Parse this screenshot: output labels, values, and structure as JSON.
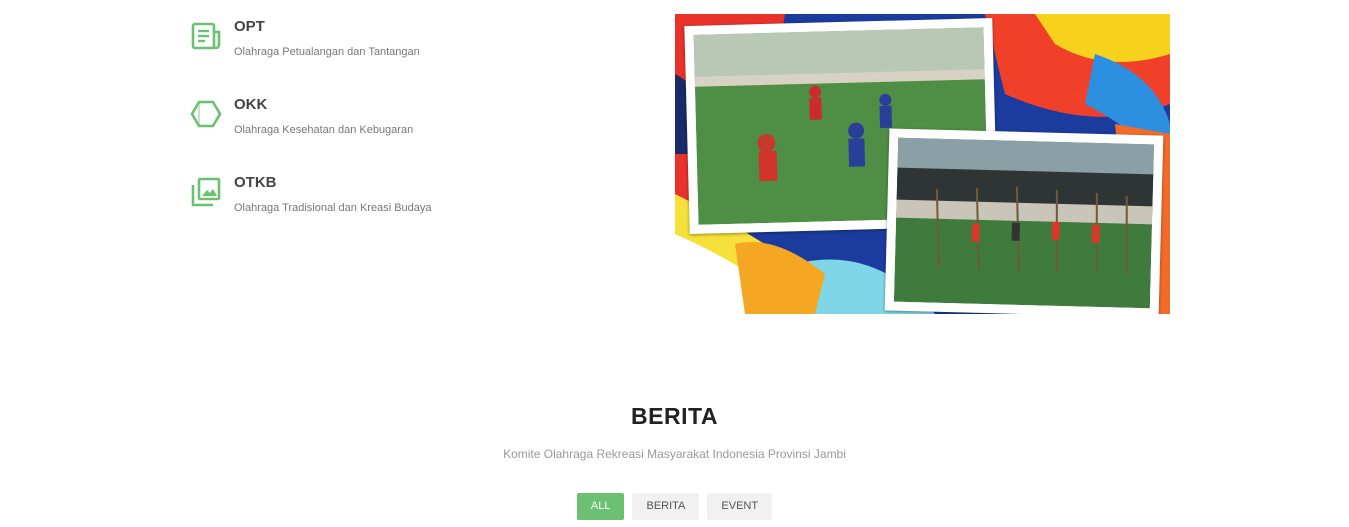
{
  "features": [
    {
      "title": "OPT",
      "subtitle": "Olahraga Petualangan dan Tantangan",
      "icon": "document-list-icon"
    },
    {
      "title": "OKK",
      "subtitle": "Olahraga Kesehatan dan Kebugaran",
      "icon": "hexagon-icon"
    },
    {
      "title": "OTKB",
      "subtitle": "Olahraga Tradisional dan Kreasi Budaya",
      "icon": "image-stack-icon"
    }
  ],
  "berita": {
    "title": "BERITA",
    "subtitle": "Komite Olahraga Rekreasi Masyarakat Indonesia Provinsi Jambi",
    "filters": [
      "ALL",
      "BERITA",
      "EVENT"
    ],
    "active_filter": "ALL"
  },
  "colors": {
    "accent": "#6cc071",
    "text": "#444444",
    "muted": "#777777"
  }
}
